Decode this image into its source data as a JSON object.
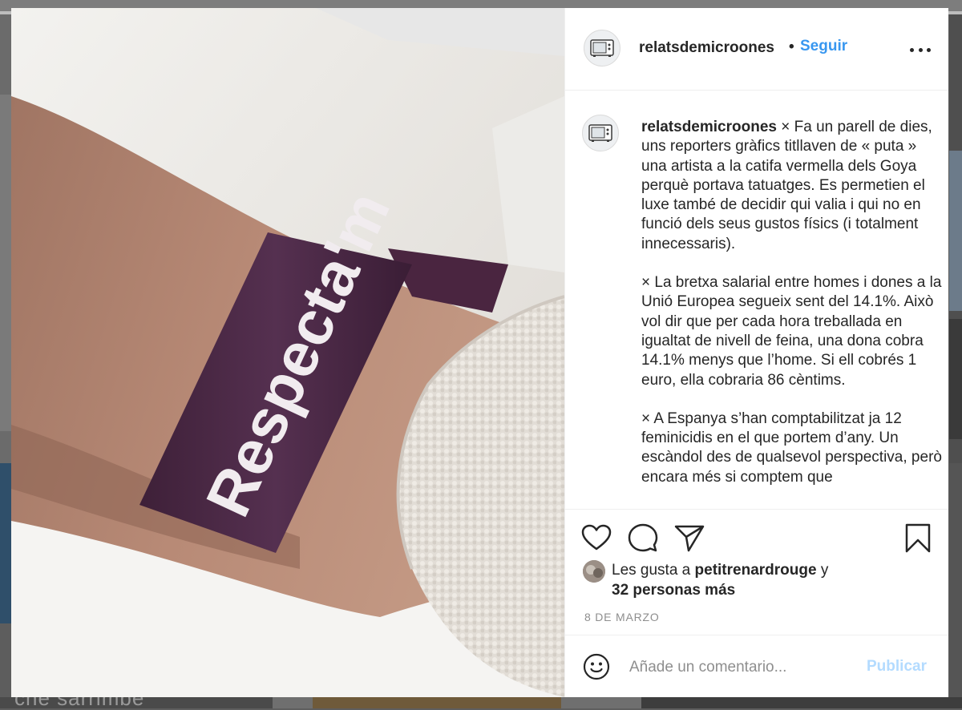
{
  "background": {
    "caption_text": "che sarrimbe"
  },
  "post": {
    "image_alt": "wrist with purple fabric wristband",
    "wristband_text": "Respecta'm",
    "header": {
      "username": "relatsdemicroones",
      "separator": "•",
      "follow_label": "Seguir",
      "more_icon": "more-horizontal-icon",
      "avatar_icon": "microwave-icon"
    },
    "caption": {
      "username": "relatsdemicroones",
      "paragraphs": [
        "× Fa un parell de dies, uns reporters gràfics titllaven de « puta » una artista a la catifa vermella dels Goya perquè portava tatuatges. Es permetien el luxe també de decidir qui valia i qui no en funció dels seus gustos físics (i totalment innecessaris).",
        "× La bretxa salarial entre homes i dones a la Unió Europea segueix sent del 14.1%. Això vol dir que per cada hora treballada en igualtat de nivell de feina, una dona cobra 14.1% menys que l’home. Si ell cobrés 1 euro, ella cobraria 86 cèntims.",
        "× A Espanya s’han comptabilitzat ja 12 feminicidis en el que portem d’any. Un escàndol des de qualsevol perspectiva, però encara més si comptem que"
      ]
    },
    "actions": {
      "like_icon": "heart-icon",
      "comment_icon": "comment-icon",
      "share_icon": "paper-plane-icon",
      "save_icon": "bookmark-icon"
    },
    "likes": {
      "prefix": "Les gusta a",
      "liker": "petitrenardrouge",
      "connector": "y",
      "others": "32 personas más"
    },
    "date": "8 DE MARZO",
    "comment": {
      "emoji_icon": "smiley-icon",
      "placeholder": "Añade un comentario...",
      "publish_label": "Publicar"
    }
  },
  "colors": {
    "link_blue": "#3897f0",
    "publish_disabled": "#b3dbff",
    "wristband_purple": "#4f2a48",
    "text_dark": "#262626",
    "text_muted": "#8e8e8e"
  }
}
